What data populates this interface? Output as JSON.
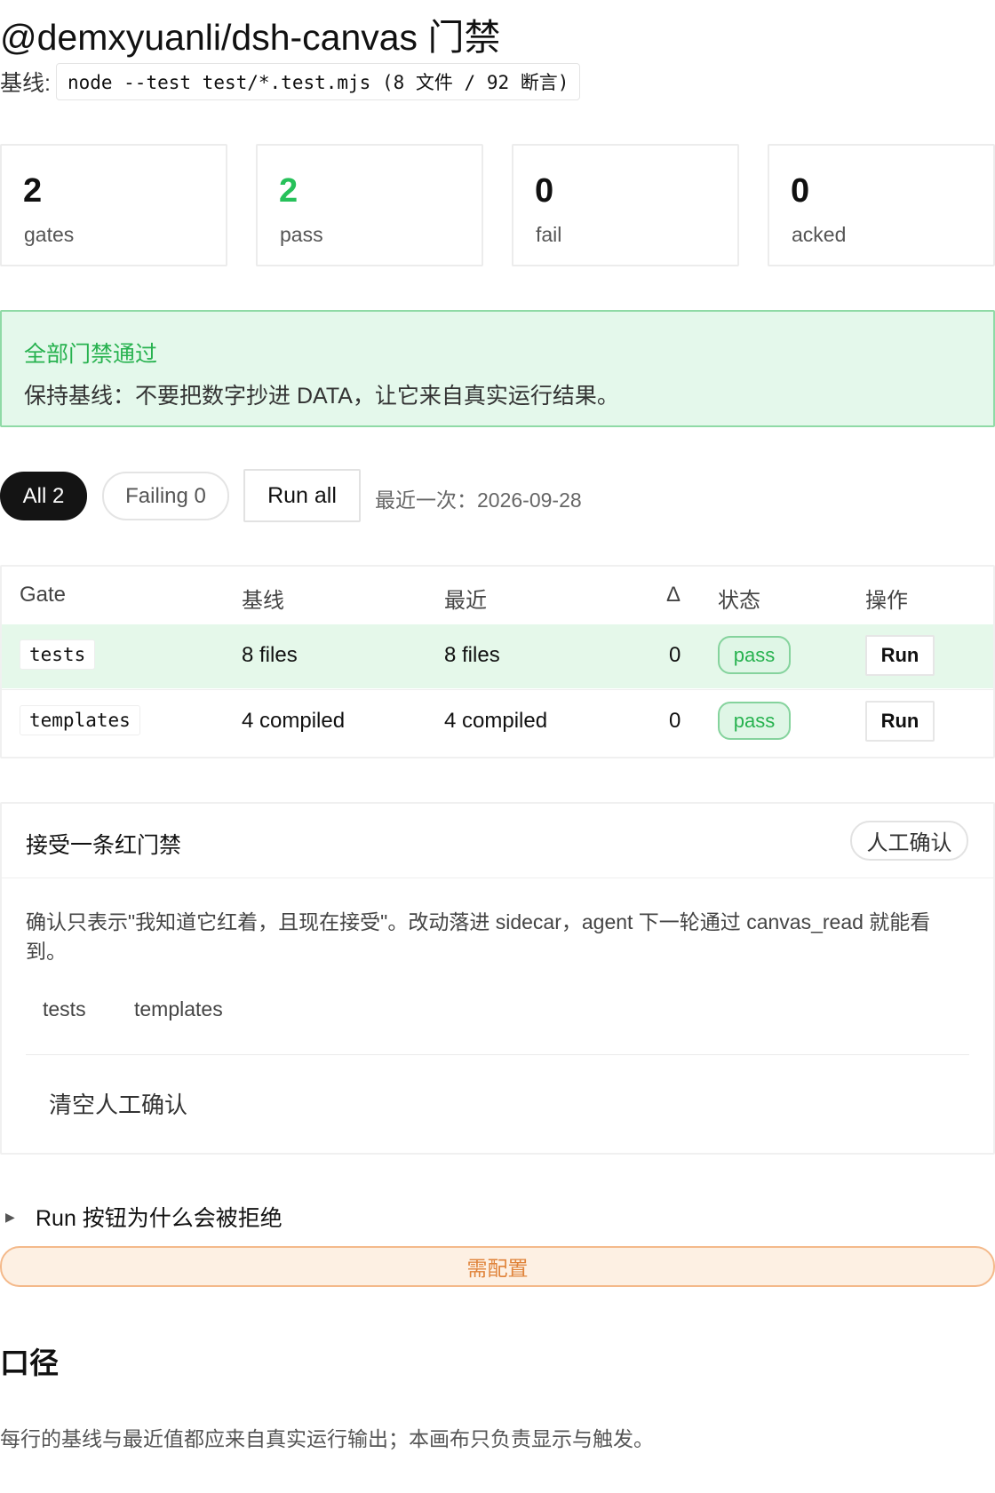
{
  "header": {
    "title": "@demxyuanli/dsh-canvas 门禁",
    "baseline_label": "基线:",
    "baseline_cmd": "node --test test/*.test.mjs (8 文件 / 92 断言)"
  },
  "stats": [
    {
      "value": "2",
      "label": "gates"
    },
    {
      "value": "2",
      "label": "pass"
    },
    {
      "value": "0",
      "label": "fail"
    },
    {
      "value": "0",
      "label": "acked"
    }
  ],
  "banner": {
    "title": "全部门禁通过",
    "text": "保持基线：不要把数字抄进 DATA，让它来自真实运行结果。"
  },
  "filters": {
    "all_label": "All 2",
    "failing_label": "Failing 0",
    "run_all_label": "Run all",
    "last_run": "最近一次：2026-09-28"
  },
  "table": {
    "headers": [
      "Gate",
      "基线",
      "最近",
      "Δ",
      "状态",
      "操作"
    ],
    "rows": [
      {
        "gate": "tests",
        "baseline": "8 files",
        "recent": "8 files",
        "delta": "0",
        "status": "pass",
        "action": "Run"
      },
      {
        "gate": "templates",
        "baseline": "4 compiled",
        "recent": "4 compiled",
        "delta": "0",
        "status": "pass",
        "action": "Run"
      }
    ]
  },
  "ack": {
    "title": "接受一条红门禁",
    "badge": "人工确认",
    "description": "确认只表示\"我知道它红着，且现在接受\"。改动落进 sidecar，agent 下一轮通过 canvas_read 就能看到。",
    "chips": [
      "tests",
      "templates"
    ],
    "clear_label": "清空人工确认"
  },
  "details": {
    "summary": "Run 按钮为什么会被拒绝",
    "config_label": "需配置"
  },
  "footer": {
    "heading": "口径",
    "text": "每行的基线与最近值都应来自真实运行输出；本画布只负责显示与触发。"
  },
  "colors": {
    "pass_green": "#27c15a",
    "banner_bg": "#e4f8eb",
    "warning_orange": "#e0833a"
  }
}
